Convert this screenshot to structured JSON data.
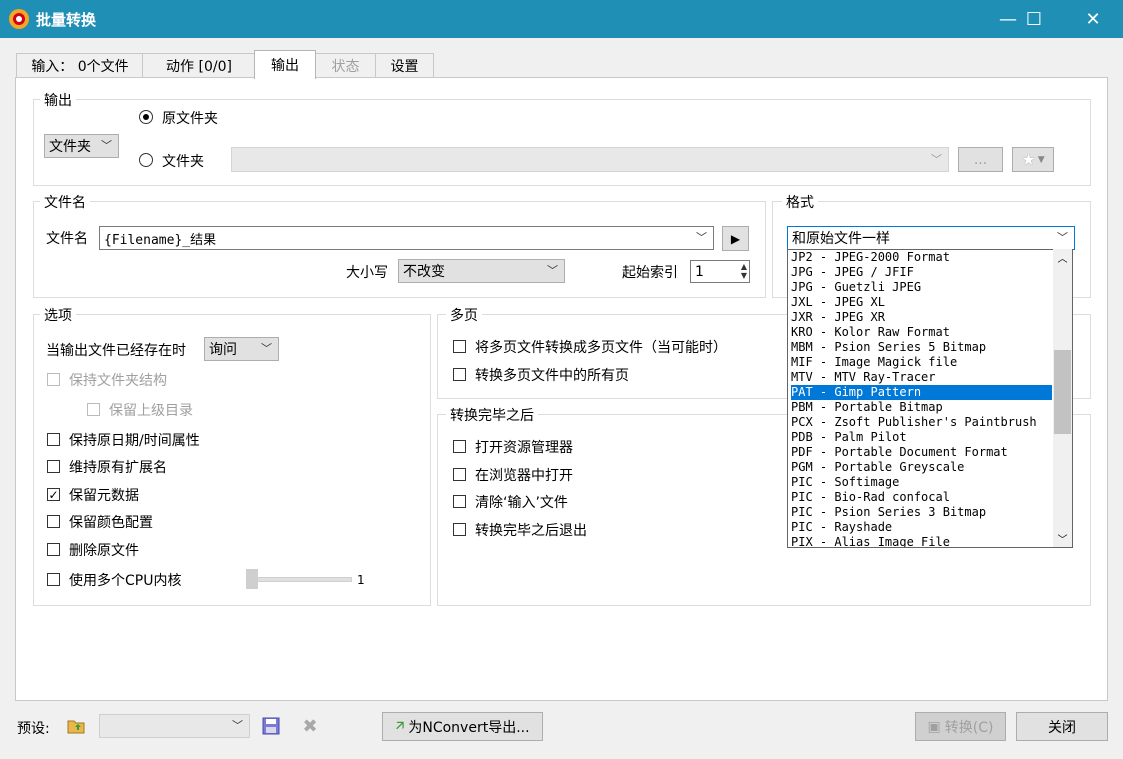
{
  "window": {
    "title": "批量转换",
    "minimize": "—",
    "maximize": "☐",
    "close": "✕"
  },
  "tabs": [
    {
      "label": "输入： 0个文件",
      "state": "normal"
    },
    {
      "label": "动作 [0/0]",
      "state": "normal"
    },
    {
      "label": "输出",
      "state": "active"
    },
    {
      "label": "状态",
      "state": "disabled"
    },
    {
      "label": "设置",
      "state": "normal"
    }
  ],
  "output_group": {
    "title": "输出",
    "folder_combo": "文件夹",
    "radio_original": "原文件夹",
    "radio_folder": "文件夹",
    "folder_path": "",
    "browse_button": "...",
    "favorite_icon": "star-icon"
  },
  "filename_group": {
    "title": "文件名",
    "label": "文件名",
    "value": "{Filename}_结果",
    "case_label": "大小写",
    "case_value": "不改变",
    "start_index_label": "起始索引",
    "start_index_value": "1"
  },
  "format_group": {
    "title": "格式",
    "selected": "和原始文件一样",
    "items": [
      "JP2 - JPEG-2000 Format",
      "JPG - JPEG / JFIF",
      "JPG - Guetzli JPEG",
      "JXL - JPEG XL",
      "JXR - JPEG XR",
      "KRO - Kolor Raw Format",
      "MBM - Psion Series 5 Bitmap",
      "MIF - Image Magick file",
      "MTV - MTV Ray-Tracer",
      "PAT - Gimp Pattern",
      "PBM - Portable Bitmap",
      "PCX - Zsoft Publisher's Paintbrush",
      "PDB - Palm Pilot",
      "PDF - Portable Document Format",
      "PGM - Portable Greyscale",
      "PIC - Softimage",
      "PIC - Bio-Rad confocal",
      "PIC - Psion Series 3 Bitmap",
      "PIC - Rayshade",
      "PIX - Alias Image File"
    ],
    "highlighted": "PAT - Gimp Pattern"
  },
  "options_group": {
    "title": "选项",
    "exists_label": "当输出文件已经存在时",
    "exists_value": "询问",
    "keep_structure": "保持文件夹结构",
    "keep_parent": "保留上级目录",
    "keep_date": "保持原日期/时间属性",
    "keep_ext": "维持原有扩展名",
    "keep_meta": "保留元数据",
    "keep_color": "保留颜色配置",
    "delete_original": "删除原文件",
    "multi_cpu": "使用多个CPU内核",
    "cpu_value": "1"
  },
  "multipage_group": {
    "title": "多页",
    "to_multipage": "将多页文件转换成多页文件（当可能时）",
    "all_pages": "转换多页文件中的所有页"
  },
  "after_group": {
    "title": "转换完毕之后",
    "open_explorer": "打开资源管理器",
    "open_browser": "在浏览器中打开",
    "clear_input": "清除‘输入’文件",
    "exit_after": "转换完毕之后退出"
  },
  "footer": {
    "preset_label": "预设:",
    "preset_value": "",
    "export_button": "为NConvert导出...",
    "convert_button": "转换(C)",
    "close_button": "关闭"
  }
}
